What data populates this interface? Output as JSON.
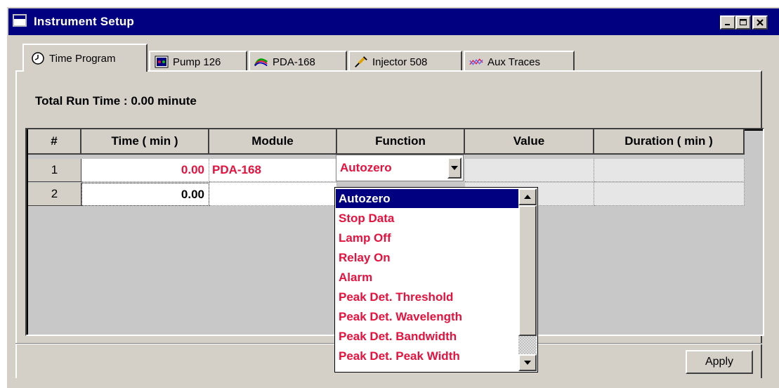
{
  "window": {
    "title": "Instrument Setup",
    "minimize_label": "_",
    "maximize_label": "□",
    "close_label": "✕"
  },
  "tabs": [
    {
      "label": "Time Program",
      "icon": "clock-icon",
      "active": true
    },
    {
      "label": "Pump 126",
      "icon": "pump-icon"
    },
    {
      "label": "PDA-168",
      "icon": "spectrum-icon"
    },
    {
      "label": "Injector 508",
      "icon": "syringe-icon"
    },
    {
      "label": "Aux Traces",
      "icon": "traces-icon"
    }
  ],
  "total_run": "Total Run Time :  0.00  minute",
  "grid": {
    "headers": [
      "#",
      "Time ( min )",
      "Module",
      "Function",
      "Value",
      "Duration ( min )"
    ],
    "rows": [
      {
        "num": "1",
        "time": "0.00",
        "module": "PDA-168",
        "function": "Autozero",
        "value": "",
        "duration": ""
      },
      {
        "num": "2",
        "time": "0.00",
        "module": "",
        "function": "",
        "value": "",
        "duration": ""
      }
    ]
  },
  "dropdown": {
    "selected": "Autozero",
    "options": [
      "Autozero",
      "Stop Data",
      "Lamp Off",
      "Relay On",
      "Alarm",
      "Peak Det. Threshold",
      "Peak Det. Wavelength",
      "Peak Det. Bandwidth",
      "Peak Det. Peak Width"
    ]
  },
  "apply_label": "Apply",
  "colors": {
    "titlebar": "#000080",
    "accent_red": "#e8103c",
    "face": "#d4d0c8"
  }
}
